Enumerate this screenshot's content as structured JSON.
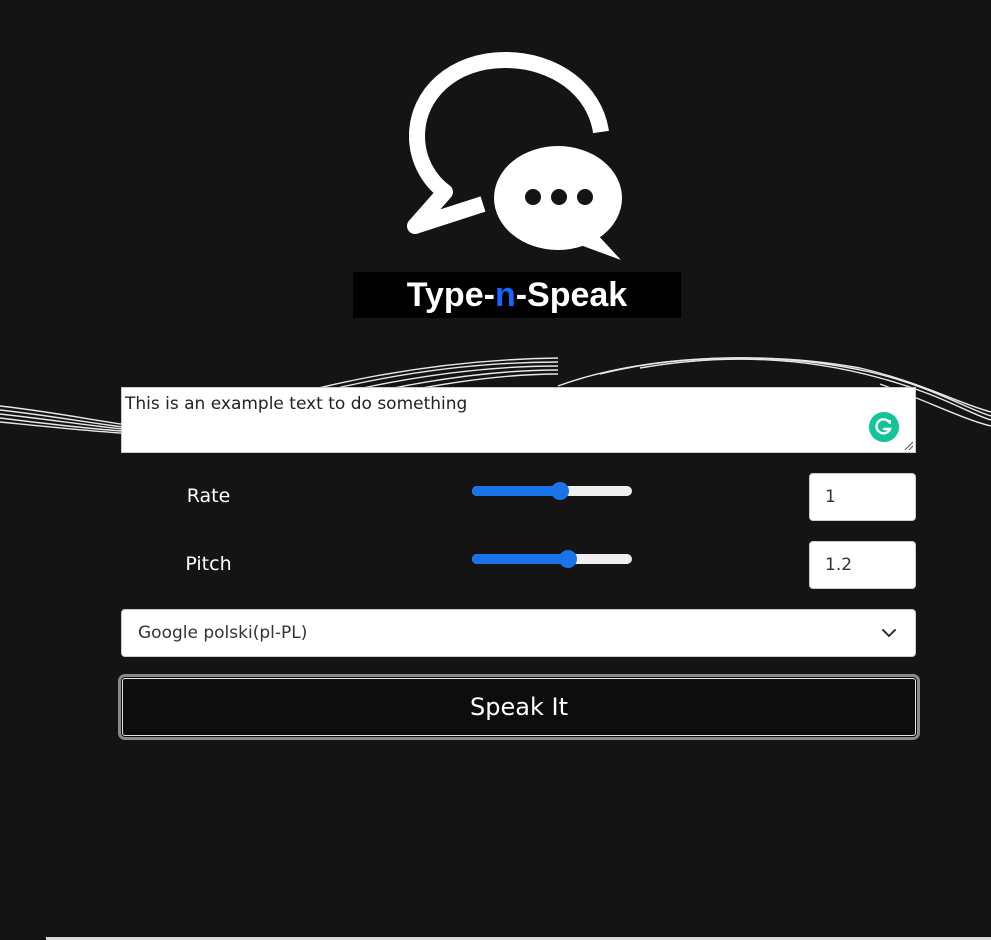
{
  "app": {
    "logo_text_before": "Type-",
    "logo_text_accent": "n",
    "logo_text_after": "-Speak",
    "accent_color": "#1565ff"
  },
  "text_input": {
    "value": "This is an example text to do something",
    "extension_icon": "grammarly-icon"
  },
  "controls": {
    "rate": {
      "label": "Rate",
      "value": "1",
      "level": 0.55
    },
    "pitch": {
      "label": "Pitch",
      "value": "1.2",
      "level": 0.6
    }
  },
  "voice_select": {
    "selected": "Google polski(pl-PL)"
  },
  "actions": {
    "speak_label": "Speak It"
  },
  "colors": {
    "background": "#141414",
    "slider_accent": "#1a73e8",
    "grammarly": "#15c39a"
  }
}
